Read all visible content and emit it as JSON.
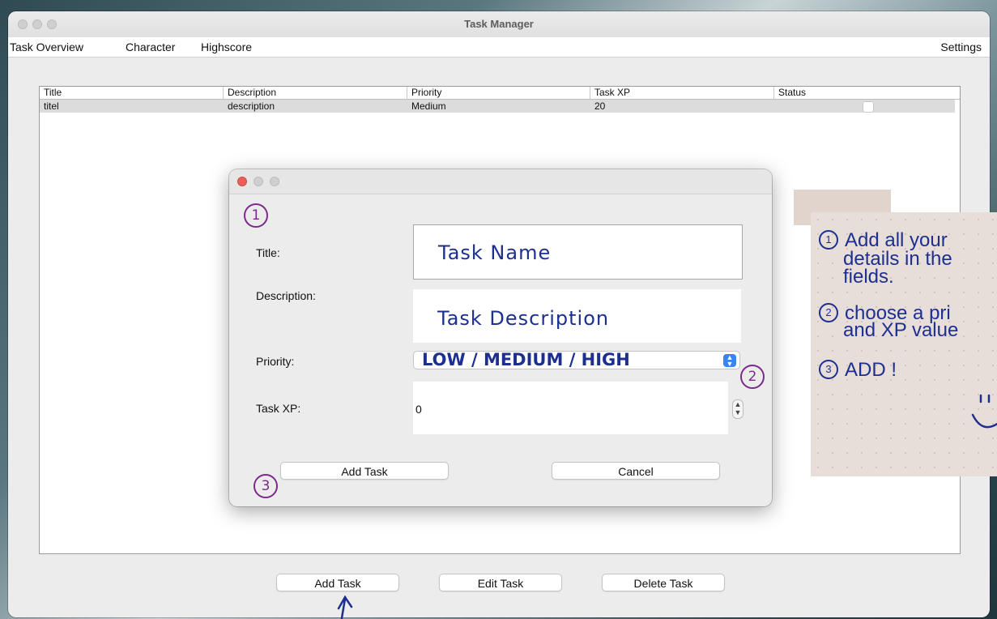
{
  "window": {
    "title": "Task Manager"
  },
  "menu": {
    "task_overview": "Task Overview",
    "character": "Character",
    "highscore": "Highscore",
    "settings": "Settings"
  },
  "table": {
    "headers": [
      "Title",
      "Description",
      "Priority",
      "Task XP",
      "Status"
    ],
    "rows": [
      {
        "title": "titel",
        "description": "description",
        "priority": "Medium",
        "task_xp": "20",
        "status_checked": false
      }
    ]
  },
  "buttons": {
    "add": "Add Task",
    "edit": "Edit Task",
    "delete": "Delete Task"
  },
  "dialog": {
    "title_label": "Title:",
    "title_value": "Task Name",
    "description_label": "Description:",
    "description_value": "Task Description",
    "priority_label": "Priority:",
    "priority_value": "LOW / MEDIUM / HIGH",
    "task_xp_label": "Task XP:",
    "task_xp_value": "0",
    "add_button": "Add Task",
    "cancel_button": "Cancel"
  },
  "annotations": {
    "step1": "1",
    "step2": "2",
    "step3": "3"
  },
  "note": {
    "line1": "Add all your",
    "line2": "details in the",
    "line3": "fields.",
    "line4": "choose a pri",
    "line5": "and XP value",
    "line6": "ADD !",
    "badge1": "1",
    "badge2": "2",
    "badge3": "3"
  },
  "colors": {
    "annotation_purple": "#7b2a8c",
    "handwriting_blue": "#1d2f8f",
    "close_red": "#ec5f59"
  }
}
